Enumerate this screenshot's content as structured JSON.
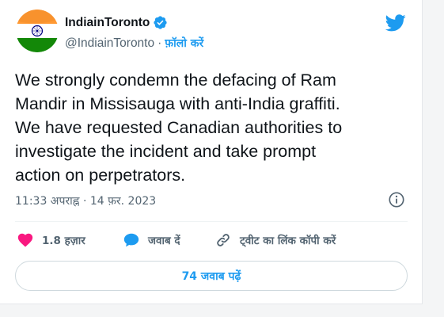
{
  "author": {
    "name": "IndiainToronto",
    "handle": "@IndiainToronto",
    "follow_label": "फ़ॉलो करें",
    "avatar": "india-flag"
  },
  "tweet": {
    "text": "We strongly condemn the defacing of Ram\nMandir in Missisauga with anti-India graffiti.\nWe have requested Canadian authorities to\ninvestigate the incident and take prompt\naction on perpetrators.",
    "timestamp": "11:33 अपराह्न · 14 फ़र. 2023"
  },
  "actions": {
    "like_count": "1.8 हज़ार",
    "reply_label": "जवाब दें",
    "copy_link_label": "ट्वीट का लिंक कॉपी करें"
  },
  "replies_button": "74 जवाब पढ़ें",
  "colors": {
    "accent": "#1d9bf0",
    "like": "#f91880",
    "text": "#0f1419",
    "secondary": "#536471"
  },
  "icons": [
    "verified-badge-icon",
    "twitter-bird-icon",
    "info-icon",
    "heart-icon",
    "reply-bubble-icon",
    "link-icon"
  ]
}
